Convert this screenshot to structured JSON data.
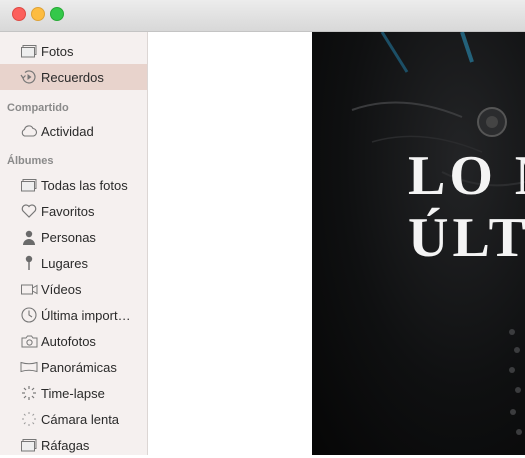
{
  "window": {
    "controls": [
      "close",
      "minimize",
      "maximize"
    ]
  },
  "sidebar": {
    "library": [
      {
        "label": "Fotos",
        "icon": "photos-icon"
      },
      {
        "label": "Recuerdos",
        "icon": "memories-icon",
        "selected": true
      }
    ],
    "shared_header": "Compartido",
    "shared": [
      {
        "label": "Actividad",
        "icon": "cloud-icon"
      }
    ],
    "albums_header": "Álbumes",
    "albums": [
      {
        "label": "Todas las fotos",
        "icon": "album-icon"
      },
      {
        "label": "Favoritos",
        "icon": "heart-icon"
      },
      {
        "label": "Personas",
        "icon": "person-icon"
      },
      {
        "label": "Lugares",
        "icon": "pin-icon"
      },
      {
        "label": "Vídeos",
        "icon": "video-icon"
      },
      {
        "label": "Última import…",
        "icon": "clock-icon"
      },
      {
        "label": "Autofotos",
        "icon": "camera-icon"
      },
      {
        "label": "Panorámicas",
        "icon": "panorama-icon"
      },
      {
        "label": "Time-lapse",
        "icon": "timelapse-icon"
      },
      {
        "label": "Cámara lenta",
        "icon": "slowmo-icon"
      },
      {
        "label": "Ráfagas",
        "icon": "burst-icon"
      }
    ]
  },
  "memory": {
    "title_line1": "LO M",
    "title_line2": "ÚLT"
  }
}
